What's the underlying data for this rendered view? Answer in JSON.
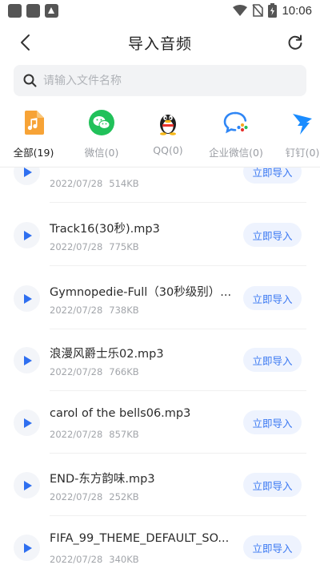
{
  "status": {
    "time": "10:06"
  },
  "header": {
    "title": "导入音频"
  },
  "search": {
    "placeholder": "请输入文件名称"
  },
  "tabs": [
    {
      "label": "全部(19)",
      "icon": "music-file-icon",
      "color": "#f7a336"
    },
    {
      "label": "微信(0)",
      "icon": "wechat-icon",
      "color": "#21c15a"
    },
    {
      "label": "QQ(0)",
      "icon": "qq-penguin-icon",
      "color": "#222222"
    },
    {
      "label": "企业微信(0)",
      "icon": "wecom-icon",
      "color": "#2f86f5"
    },
    {
      "label": "钉钉(0)",
      "icon": "dingtalk-icon",
      "color": "#1a8cff"
    }
  ],
  "files": [
    {
      "name": "",
      "date": "2022/07/28",
      "size": "514KB",
      "action": "立即导入"
    },
    {
      "name": "Track16(30秒).mp3",
      "date": "2022/07/28",
      "size": "775KB",
      "action": "立即导入"
    },
    {
      "name": "Gymnopedie-Full（30秒级别）...",
      "date": "2022/07/28",
      "size": "738KB",
      "action": "立即导入"
    },
    {
      "name": "浪漫风爵士乐02.mp3",
      "date": "2022/07/28",
      "size": "766KB",
      "action": "立即导入"
    },
    {
      "name": "carol of the bells06.mp3",
      "date": "2022/07/28",
      "size": "857KB",
      "action": "立即导入"
    },
    {
      "name": "END-东方韵味.mp3",
      "date": "2022/07/28",
      "size": "252KB",
      "action": "立即导入"
    },
    {
      "name": "FIFA_99_THEME_DEFAULT_SO...",
      "date": "2022/07/28",
      "size": "340KB",
      "action": "立即导入"
    }
  ],
  "colors": {
    "accent": "#3a78f2",
    "import_bg": "#eef3fe",
    "play": "#2f6ff0"
  }
}
